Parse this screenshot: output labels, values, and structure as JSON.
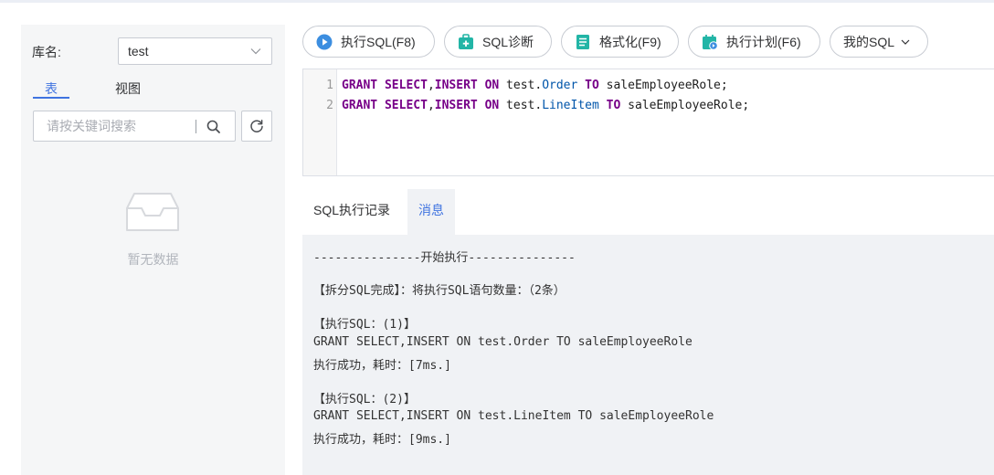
{
  "sidebar": {
    "db_label": "库名:",
    "db_value": "test",
    "tabs": {
      "table": "表",
      "view": "视图"
    },
    "search_placeholder": "请按关键词搜索",
    "empty_text": "暂无数据"
  },
  "toolbar": {
    "run": "执行SQL(F8)",
    "diagnose": "SQL诊断",
    "format": "格式化(F9)",
    "plan": "执行计划(F6)",
    "my_sql": "我的SQL"
  },
  "editor": {
    "line_numbers": [
      "1",
      "2"
    ],
    "lines": [
      {
        "kw1": "GRANT",
        "kw2": "SELECT",
        "sep1": ",",
        "kw3": "INSERT",
        "kw4": "ON",
        "obj_prefix": " test.",
        "obj": "Order",
        "kw5": "TO",
        "role": " saleEmployeeRole;"
      },
      {
        "kw1": "GRANT",
        "kw2": "SELECT",
        "sep1": ",",
        "kw3": "INSERT",
        "kw4": "ON",
        "obj_prefix": " test.",
        "obj": "LineItem",
        "kw5": "TO",
        "role": " saleEmployeeRole;"
      }
    ]
  },
  "result_tabs": {
    "history": "SQL执行记录",
    "messages": "消息"
  },
  "output": {
    "lines": [
      "---------------开始执行---------------",
      "【拆分SQL完成】：将执行SQL语句数量：（2条）",
      "【执行SQL：(1)】",
      "GRANT SELECT,INSERT ON test.Order TO saleEmployeeRole",
      "执行成功，耗时：[7ms.]",
      "【执行SQL：(2)】",
      "GRANT SELECT,INSERT ON test.LineItem TO saleEmployeeRole",
      "执行成功，耗时：[9ms.]"
    ]
  },
  "colors": {
    "accent": "#3f73e0",
    "run_icon": "#3c8ee0",
    "teal_icon": "#22b5a6",
    "keyword": "#770088",
    "object": "#0055aa"
  },
  "icons": [
    "chevron-down-icon",
    "search-icon",
    "refresh-icon",
    "empty-inbox-icon",
    "play-icon",
    "medkit-icon",
    "format-doc-icon",
    "plan-calendar-icon"
  ]
}
